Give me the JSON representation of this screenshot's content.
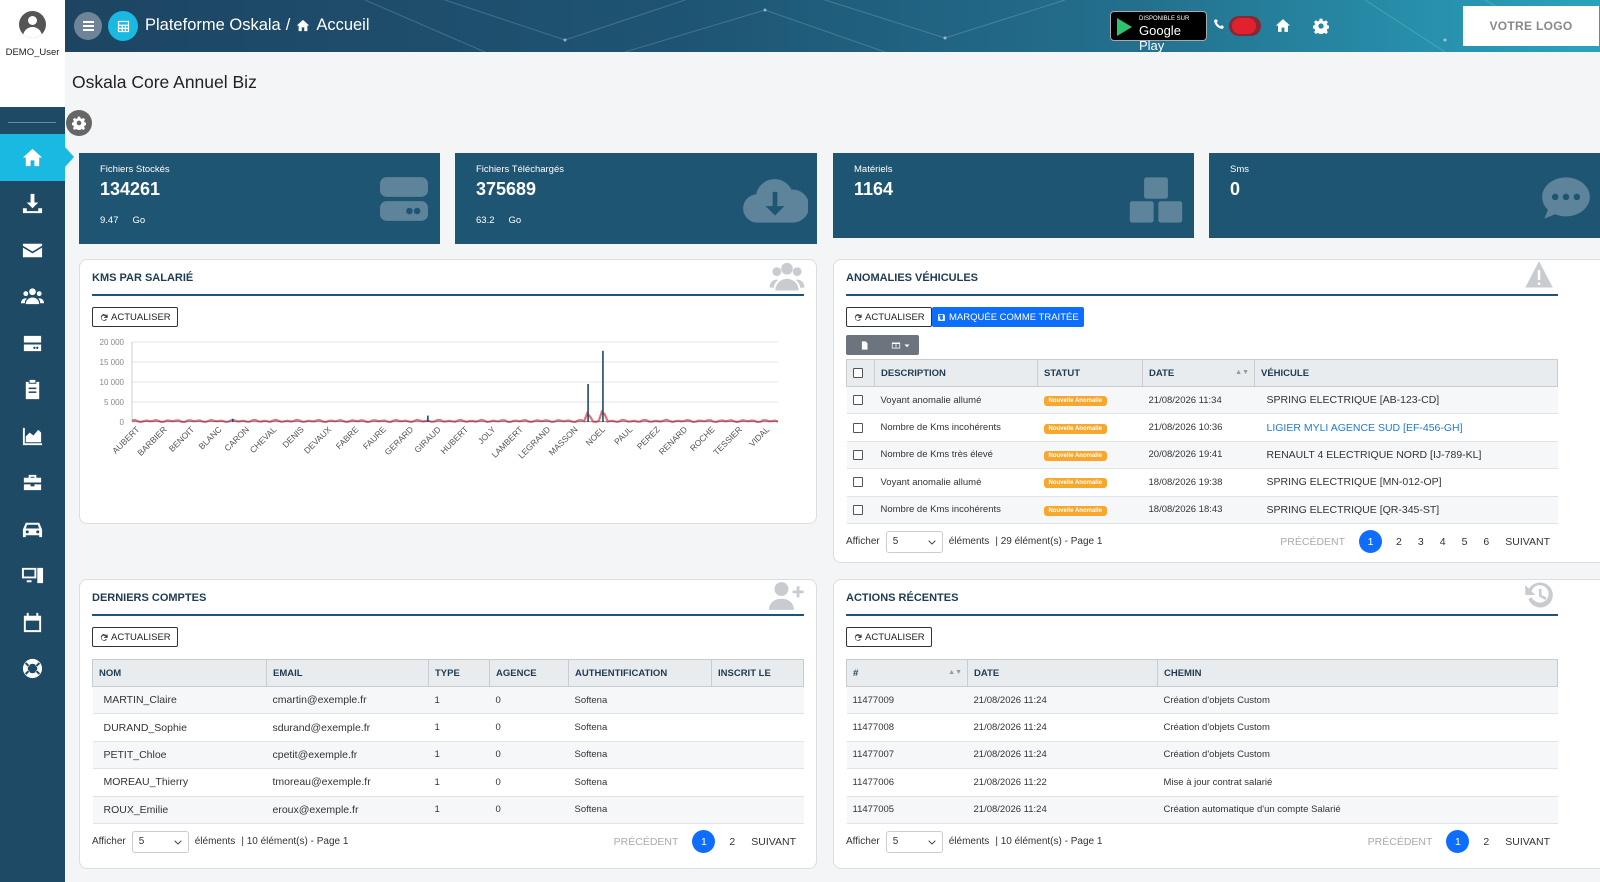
{
  "user": {
    "name": "DEMO_User"
  },
  "header": {
    "platform": "Plateforme Oskala",
    "separator": "/",
    "current": "Accueil",
    "gplay_small": "DISPONIBLE SUR",
    "gplay_big": "Google Play",
    "logo": "VOTRE LOGO"
  },
  "page": {
    "title": "Oskala Core Annuel Biz"
  },
  "stats": [
    {
      "label": "Fichiers Stockés",
      "value": "134261",
      "sub_value": "9.47",
      "sub_unit": "Go",
      "icon": "hdd-icon"
    },
    {
      "label": "Fichiers Téléchargés",
      "value": "375689",
      "sub_value": "63.2",
      "sub_unit": "Go",
      "icon": "cloud-download-icon"
    },
    {
      "label": "Matériels",
      "value": "1164",
      "icon": "boxes-icon"
    },
    {
      "label": "Sms",
      "value": "0",
      "icon": "comment-icon"
    }
  ],
  "kms": {
    "title": "KMS PAR SALARIÉ",
    "refresh": "ACTUALISER"
  },
  "chart_data": {
    "type": "line",
    "title": "",
    "xlabel": "",
    "ylabel": "",
    "ylim": [
      0,
      20000
    ],
    "yticks": [
      "20 000",
      "15 000",
      "10 000",
      "5 000",
      "0"
    ],
    "categories": [
      "AUBERT",
      "BARBIER",
      "BENOIT",
      "BLANC",
      "CARON",
      "CHEVAL",
      "DENIS",
      "DEVAUX",
      "FABRE",
      "FAURE",
      "GERARD",
      "GIRAUD",
      "HUBERT",
      "JOLY",
      "LAMBERT",
      "LEGRAND",
      "MASSON",
      "NOEL",
      "PAUL",
      "PEREZ",
      "RENARD",
      "ROCHE",
      "TESSIER",
      "VIDAL"
    ],
    "series": [
      {
        "color": "#1e4a66",
        "spikes": [
          {
            "x": 0.706,
            "y": 9500
          },
          {
            "x": 0.729,
            "y": 17800
          },
          {
            "x": 0.458,
            "y": 1600
          },
          {
            "x": 0.156,
            "y": 800
          }
        ]
      },
      {
        "color": "#e05560",
        "baseline": 0,
        "peaks": [
          {
            "x": 0.706,
            "y": 2800
          },
          {
            "x": 0.729,
            "y": 3600
          }
        ]
      }
    ],
    "grid": true
  },
  "anomalies": {
    "title": "ANOMALIES VÉHICULES",
    "refresh": "ACTUALISER",
    "mark": "MARQUÉE COMME TRAITÉE",
    "columns": [
      "DESCRIPTION",
      "STATUT",
      "DATE",
      "VÉHICULE"
    ],
    "rows": [
      {
        "desc": "Voyant anomalie allumé",
        "status": "Nouvelle Anomalie",
        "date": "21/08/2026 11:34",
        "vehicle": "SPRING ELECTRIQUE [AB-123-CD]",
        "link": false
      },
      {
        "desc": "Nombre de Kms incohérents",
        "status": "Nouvelle Anomalie",
        "date": "21/08/2026 10:36",
        "vehicle": "LIGIER MYLI AGENCE SUD [EF-456-GH]",
        "link": true
      },
      {
        "desc": "Nombre de Kms très élevé",
        "status": "Nouvelle Anomalie",
        "date": "20/08/2026 19:41",
        "vehicle": "RENAULT 4 ELECTRIQUE NORD [IJ-789-KL]",
        "link": false
      },
      {
        "desc": "Voyant anomalie allumé",
        "status": "Nouvelle Anomalie",
        "date": "18/08/2026 19:38",
        "vehicle": "SPRING ELECTRIQUE [MN-012-OP]",
        "link": false
      },
      {
        "desc": "Nombre de Kms incohérents",
        "status": "Nouvelle Anomalie",
        "date": "18/08/2026 18:43",
        "vehicle": "SPRING ELECTRIQUE [QR-345-ST]",
        "link": false
      }
    ],
    "show": "Afficher",
    "per_page": "5",
    "elements": "éléments",
    "info": "| 29 élément(s) - Page 1",
    "prev": "PRÉCÉDENT",
    "pages": [
      "1",
      "2",
      "3",
      "4",
      "5",
      "6"
    ],
    "next": "SUIVANT"
  },
  "accounts": {
    "title": "DERNIERS COMPTES",
    "refresh": "ACTUALISER",
    "columns": [
      "NOM",
      "EMAIL",
      "TYPE",
      "AGENCE",
      "AUTHENTIFICATION",
      "INSCRIT LE"
    ],
    "rows": [
      {
        "nom": "MARTIN_Claire",
        "email": "cmartin@exemple.fr",
        "type": "1",
        "agence": "0",
        "auth": "Softena",
        "inscrit": ""
      },
      {
        "nom": "DURAND_Sophie",
        "email": "sdurand@exemple.fr",
        "type": "1",
        "agence": "0",
        "auth": "Softena",
        "inscrit": ""
      },
      {
        "nom": "PETIT_Chloe",
        "email": "cpetit@exemple.fr",
        "type": "1",
        "agence": "0",
        "auth": "Softena",
        "inscrit": ""
      },
      {
        "nom": "MOREAU_Thierry",
        "email": "tmoreau@exemple.fr",
        "type": "1",
        "agence": "0",
        "auth": "Softena",
        "inscrit": ""
      },
      {
        "nom": "ROUX_Emilie",
        "email": "eroux@exemple.fr",
        "type": "1",
        "agence": "0",
        "auth": "Softena",
        "inscrit": ""
      }
    ],
    "show": "Afficher",
    "per_page": "5",
    "elements": "éléments",
    "info": "| 10 élément(s) - Page 1",
    "prev": "PRÉCÉDENT",
    "pages": [
      "1",
      "2"
    ],
    "next": "SUIVANT"
  },
  "actions": {
    "title": "ACTIONS RÉCENTES",
    "refresh": "ACTUALISER",
    "columns": [
      "#",
      "DATE",
      "CHEMIN"
    ],
    "rows": [
      {
        "id": "11477009",
        "date": "21/08/2026 11:24",
        "path": "Création d'objets Custom"
      },
      {
        "id": "11477008",
        "date": "21/08/2026 11:24",
        "path": "Création d'objets Custom"
      },
      {
        "id": "11477007",
        "date": "21/08/2026 11:24",
        "path": "Création d'objets Custom"
      },
      {
        "id": "11477006",
        "date": "21/08/2026 11:22",
        "path": "Mise à jour contrat salarié"
      },
      {
        "id": "11477005",
        "date": "21/08/2026 11:24",
        "path": "Création automatique d'un compte Salarié"
      }
    ],
    "show": "Afficher",
    "per_page": "5",
    "elements": "éléments",
    "info": "| 10 élément(s) - Page 1",
    "prev": "PRÉCÉDENT",
    "pages": [
      "1",
      "2"
    ],
    "next": "SUIVANT"
  },
  "colors": {
    "sidebar": "#1e4a66",
    "accent": "#19b9e1",
    "primary": "#0d6efd",
    "badge": "#f7a72d",
    "card": "#1e5573"
  }
}
